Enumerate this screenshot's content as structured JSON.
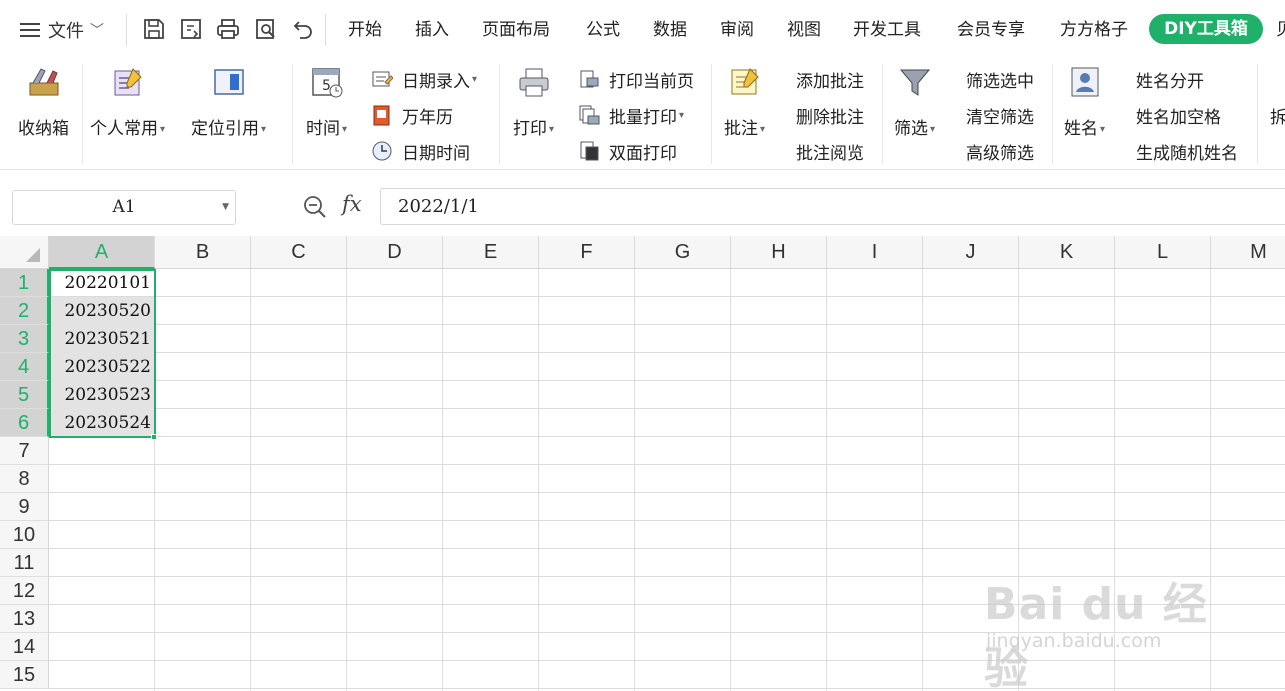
{
  "menubar": {
    "file_label": "文件",
    "tabs": [
      "开始",
      "插入",
      "页面布局",
      "公式",
      "数据",
      "审阅",
      "视图",
      "开发工具",
      "会员专享",
      "方方格子"
    ],
    "active_tab": "DIY工具箱",
    "overflow_tab": "贝",
    "accent_color": "#1fb169"
  },
  "ribbon": {
    "shoucang": "收纳箱",
    "personal": "个人常用",
    "locate": "定位引用",
    "time": "时间",
    "date_entry": "日期录入",
    "calendar": "万年历",
    "datetime": "日期时间",
    "print": "打印",
    "print_current": "打印当前页",
    "batch_print": "批量打印",
    "duplex_print": "双面打印",
    "comment": "批注",
    "add_comment": "添加批注",
    "delete_comment": "删除批注",
    "view_comment": "批注阅览",
    "filter": "筛选",
    "filter_selected": "筛选选中",
    "clear_filter": "清空筛选",
    "advanced_filter": "高级筛选",
    "name": "姓名",
    "split_name": "姓名分开",
    "name_add_space": "姓名加空格",
    "random_name": "生成随机姓名",
    "overflow_label": "拆"
  },
  "formula": {
    "cell_ref": "A1",
    "fx_label": "fx",
    "value": "2022/1/1"
  },
  "sheet": {
    "columns": [
      "A",
      "B",
      "C",
      "D",
      "E",
      "F",
      "G",
      "H",
      "I",
      "J",
      "K",
      "L",
      "M"
    ],
    "rows": [
      "1",
      "2",
      "3",
      "4",
      "5",
      "6",
      "7",
      "8",
      "9",
      "10",
      "11",
      "12",
      "13",
      "14",
      "15"
    ],
    "cells_A": [
      "20220101",
      "20230520",
      "20230521",
      "20230522",
      "20230523",
      "20230524"
    ],
    "selection_color": "#1fb169"
  },
  "watermark": {
    "main": "Bai du 经验",
    "sub": "jingyan.baidu.com"
  }
}
